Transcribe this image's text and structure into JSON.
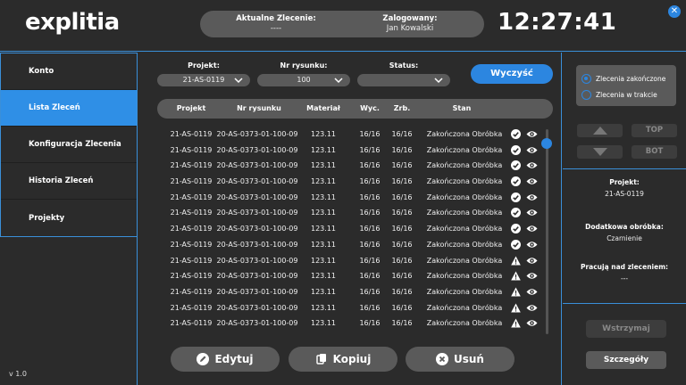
{
  "app": {
    "logo": "explitia",
    "clock": "12:27:41",
    "version": "v 1.0"
  },
  "header": {
    "order_label": "Aktualne Zlecenie:",
    "order_value": "----",
    "user_label": "Zalogowany:",
    "user_value": "Jan Kowalski"
  },
  "sidebar": {
    "items": [
      {
        "label": "Konto",
        "active": false
      },
      {
        "label": "Lista Zleceń",
        "active": true
      },
      {
        "label": "Konfiguracja Zlecenia",
        "active": false
      },
      {
        "label": "Historia Zleceń",
        "active": false
      },
      {
        "label": "Projekty",
        "active": false
      }
    ]
  },
  "filters": {
    "project_label": "Projekt:",
    "project_value": "21-AS-0119",
    "drawing_label": "Nr rysunku:",
    "drawing_value": "100",
    "status_label": "Status:",
    "status_value": "",
    "clear_label": "Wyczyść"
  },
  "table": {
    "headers": [
      "Projekt",
      "Nr rysunku",
      "Materiał",
      "Wyc.",
      "Zrb.",
      "Stan"
    ],
    "rows": [
      {
        "project": "21-AS-0119",
        "drawing": "20-AS-0373-01-100-09",
        "material": "123.11",
        "cut": "16/16",
        "done": "16/16",
        "state": "Zakończona Obróbka",
        "icon": "check"
      },
      {
        "project": "21-AS-0119",
        "drawing": "20-AS-0373-01-100-09",
        "material": "123.11",
        "cut": "16/16",
        "done": "16/16",
        "state": "Zakończona Obróbka",
        "icon": "check"
      },
      {
        "project": "21-AS-0119",
        "drawing": "20-AS-0373-01-100-09",
        "material": "123.11",
        "cut": "16/16",
        "done": "16/16",
        "state": "Zakończona Obróbka",
        "icon": "check"
      },
      {
        "project": "21-AS-0119",
        "drawing": "20-AS-0373-01-100-09",
        "material": "123.11",
        "cut": "16/16",
        "done": "16/16",
        "state": "Zakończona Obróbka",
        "icon": "check"
      },
      {
        "project": "21-AS-0119",
        "drawing": "20-AS-0373-01-100-09",
        "material": "123.11",
        "cut": "16/16",
        "done": "16/16",
        "state": "Zakończona Obróbka",
        "icon": "check"
      },
      {
        "project": "21-AS-0119",
        "drawing": "20-AS-0373-01-100-09",
        "material": "123.11",
        "cut": "16/16",
        "done": "16/16",
        "state": "Zakończona Obróbka",
        "icon": "check"
      },
      {
        "project": "21-AS-0119",
        "drawing": "20-AS-0373-01-100-09",
        "material": "123.11",
        "cut": "16/16",
        "done": "16/16",
        "state": "Zakończona Obróbka",
        "icon": "check"
      },
      {
        "project": "21-AS-0119",
        "drawing": "20-AS-0373-01-100-09",
        "material": "123.11",
        "cut": "16/16",
        "done": "16/16",
        "state": "Zakończona Obróbka",
        "icon": "check"
      },
      {
        "project": "21-AS-0119",
        "drawing": "20-AS-0373-01-100-09",
        "material": "123.11",
        "cut": "16/16",
        "done": "16/16",
        "state": "Zakończona Obróbka",
        "icon": "warning"
      },
      {
        "project": "21-AS-0119",
        "drawing": "20-AS-0373-01-100-09",
        "material": "123.11",
        "cut": "16/16",
        "done": "16/16",
        "state": "Zakończona Obróbka",
        "icon": "warning"
      },
      {
        "project": "21-AS-0119",
        "drawing": "20-AS-0373-01-100-09",
        "material": "123.11",
        "cut": "16/16",
        "done": "16/16",
        "state": "Zakończona Obróbka",
        "icon": "warning"
      },
      {
        "project": "21-AS-0119",
        "drawing": "20-AS-0373-01-100-09",
        "material": "123.11",
        "cut": "16/16",
        "done": "16/16",
        "state": "Zakończona Obróbka",
        "icon": "warning"
      },
      {
        "project": "21-AS-0119",
        "drawing": "20-AS-0373-01-100-09",
        "material": "123.11",
        "cut": "16/16",
        "done": "16/16",
        "state": "Zakończona Obróbka",
        "icon": "warning"
      }
    ]
  },
  "actions": {
    "edit_label": "Edytuj",
    "copy_label": "Kopiuj",
    "delete_label": "Usuń"
  },
  "right_panel": {
    "radio_completed": "Zlecenia zakończone",
    "radio_in_progress": "Zlecenia w trakcie",
    "selected": "completed",
    "top_label": "TOP",
    "bot_label": "BOT",
    "project_label": "Projekt:",
    "project_value": "21-AS-0119",
    "extra_label": "Dodatkowa obróbka:",
    "extra_value": "Czarnienie",
    "working_label": "Pracują nad zleceniem:",
    "working_value": "---",
    "pause_label": "Wstrzymaj",
    "details_label": "Szczegóły"
  },
  "colors": {
    "accent": "#2c86e0",
    "panel": "#5a5a5a",
    "background": "#2b2b2b"
  }
}
